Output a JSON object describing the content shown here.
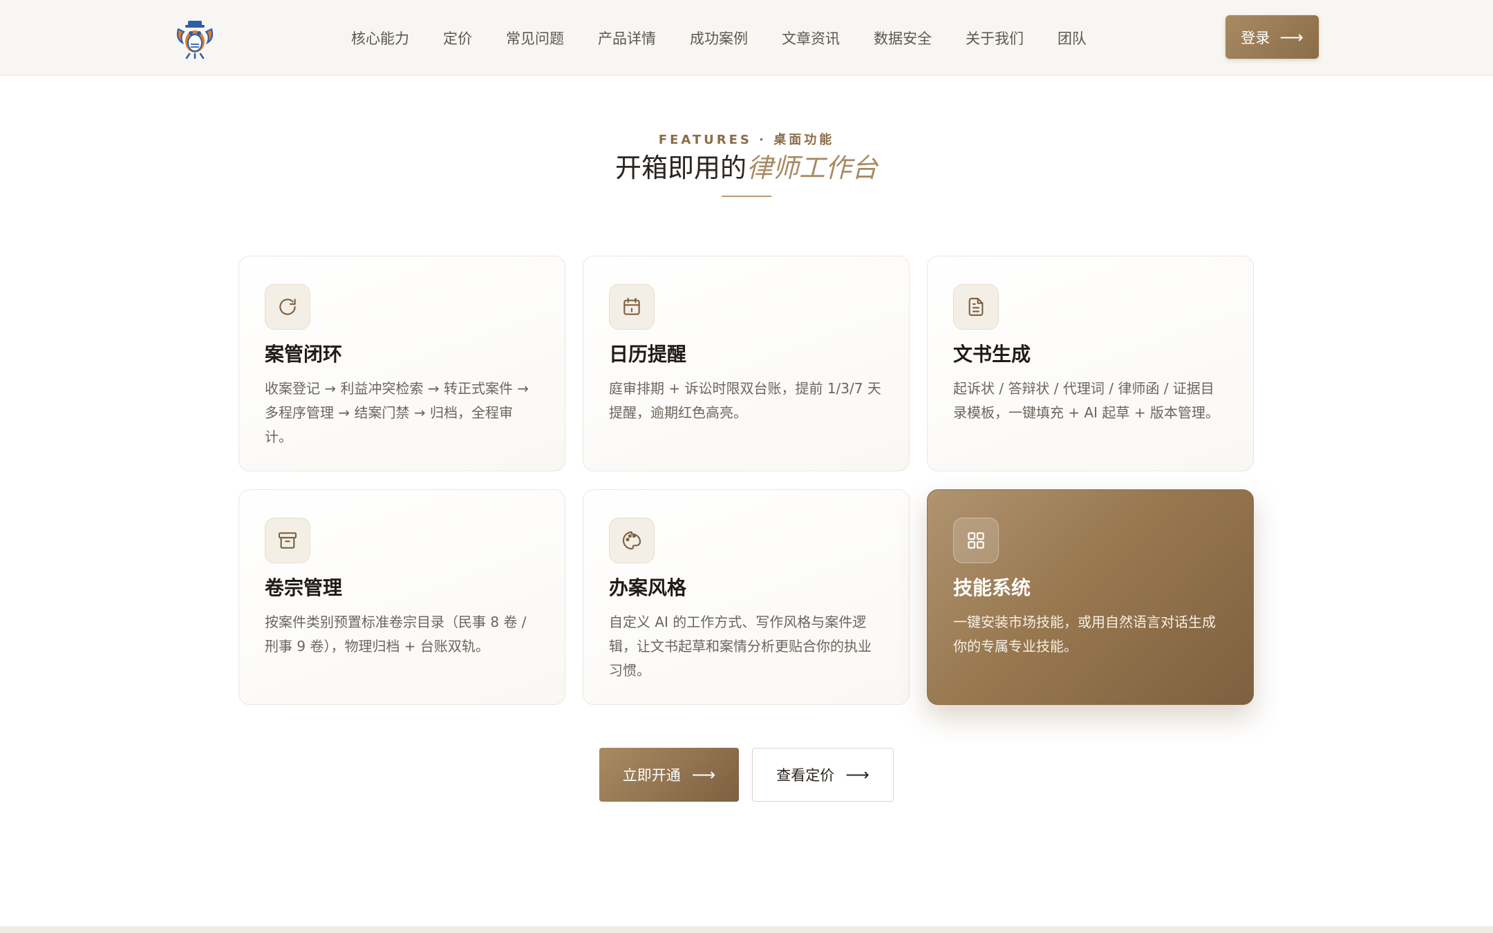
{
  "header": {
    "nav": [
      "核心能力",
      "定价",
      "常见问题",
      "产品详情",
      "成功案例",
      "文章资讯",
      "数据安全",
      "关于我们",
      "团队"
    ],
    "login_label": "登录",
    "login_arrow": "⟶"
  },
  "section": {
    "eyebrow": "FEATURES · 桌面功能",
    "title_plain": "开箱即用的",
    "title_accent": "律师工作台"
  },
  "cards": [
    {
      "icon": "refresh-icon",
      "title": "案管闭环",
      "desc": "收案登记 → 利益冲突检索 → 转正式案件 → 多程序管理 → 结案门禁 → 归档，全程审计。"
    },
    {
      "icon": "calendar-icon",
      "title": "日历提醒",
      "desc": "庭审排期 + 诉讼时限双台账，提前 1/3/7 天提醒，逾期红色高亮。"
    },
    {
      "icon": "document-icon",
      "title": "文书生成",
      "desc": "起诉状 / 答辩状 / 代理词 / 律师函 / 证据目录模板，一键填充 + AI 起草 + 版本管理。"
    },
    {
      "icon": "archive-icon",
      "title": "卷宗管理",
      "desc": "按案件类别预置标准卷宗目录（民事 8 卷 / 刑事 9 卷），物理归档 + 台账双轨。"
    },
    {
      "icon": "palette-icon",
      "title": "办案风格",
      "desc": "自定义 AI 的工作方式、写作风格与案件逻辑，让文书起草和案情分析更贴合你的执业习惯。"
    },
    {
      "icon": "grid-icon",
      "title": "技能系统",
      "desc": "一键安装市场技能，或用自然语言对话生成你的专属专业技能。"
    }
  ],
  "cta": {
    "primary_label": "立即开通",
    "secondary_label": "查看定价",
    "arrow": "⟶"
  },
  "colors": {
    "accent": "#a88b63",
    "accent_dark": "#7e6040",
    "header_bg": "#f8f6f2"
  }
}
